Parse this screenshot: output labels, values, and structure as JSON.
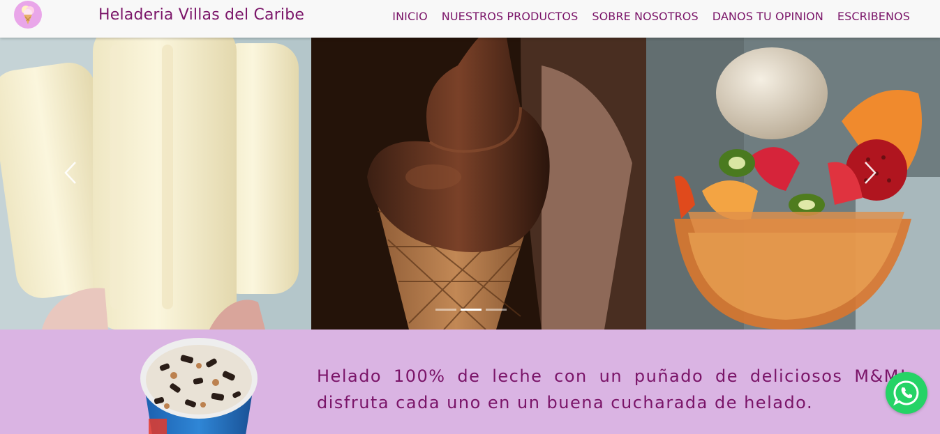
{
  "header": {
    "brand": "Heladeria Villas del Caribe",
    "logo_icon": "ice-cream-cone-icon",
    "nav": [
      "INICIO",
      "NUESTROS PRODUCTOS",
      "SOBRE NOSOTROS",
      "DANOS TU OPINION",
      "ESCRIBENOS"
    ]
  },
  "carousel": {
    "prev_icon": "chevron-left-icon",
    "next_icon": "chevron-right-icon",
    "slide_count": 3,
    "active_index": 1
  },
  "product": {
    "description_line1": "Helado 100% de leche con un puñado de deliciosos M&M!",
    "description_line2": "disfruta cada uno en un buena cucharada de helado."
  },
  "whatsapp": {
    "icon": "whatsapp-icon"
  },
  "colors": {
    "accent": "#7a1468",
    "navbar_bg": "#f8f8f8",
    "section_bg": "#dab4e3",
    "whatsapp": "#25d366"
  }
}
